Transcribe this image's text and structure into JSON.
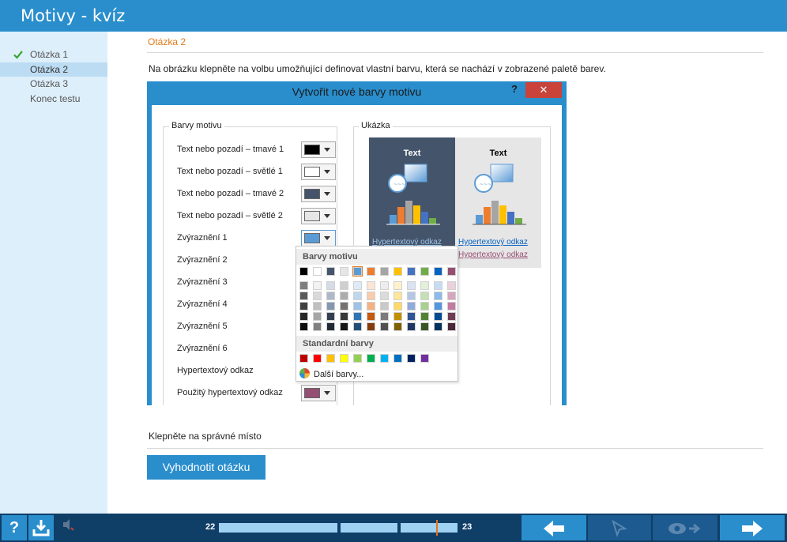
{
  "app": {
    "title": "Motivy - kvíz"
  },
  "sidebar": {
    "items": [
      {
        "label": "Otázka  1",
        "done": true
      },
      {
        "label": "Otázka  2",
        "active": true
      },
      {
        "label": "Otázka  3"
      },
      {
        "label": "Konec testu"
      }
    ]
  },
  "question": {
    "title": "Otázka  2",
    "text": "Na obrázku klepněte na volbu umožňující definovat vlastní barvu, která se nachází v zobrazené paletě barev.",
    "instruction": "Klepněte na správné místo",
    "evaluate_label": "Vyhodnotit otázku"
  },
  "dialog": {
    "title": "Vytvořit nové barvy motivu",
    "help": "?",
    "close": "✕",
    "group_colors": "Barvy motivu",
    "group_preview": "Ukázka",
    "rows": [
      {
        "label": "Text nebo pozadí – tmavé 1",
        "color": "#000000"
      },
      {
        "label": "Text nebo pozadí – světlé 1",
        "color": "#ffffff"
      },
      {
        "label": "Text nebo pozadí – tmavé 2",
        "color": "#44546a"
      },
      {
        "label": "Text nebo pozadí – světlé 2",
        "color": "#e7e6e6"
      },
      {
        "label": "Zvýraznění 1",
        "color": "#5b9bd5"
      },
      {
        "label": "Zvýraznění 2"
      },
      {
        "label": "Zvýraznění 3"
      },
      {
        "label": "Zvýraznění 4"
      },
      {
        "label": "Zvýraznění 5"
      },
      {
        "label": "Zvýraznění 6"
      },
      {
        "label": "Hypertextový odkaz"
      },
      {
        "label": "Použitý hypertextový odkaz",
        "color": "#954f72"
      }
    ],
    "preview": {
      "text_dark": "Text",
      "text_light": "Text",
      "link_dark": "Hypertextový odkaz",
      "link_light": "Hypertextový odkaz",
      "visited_light": "Hypertextový odkaz"
    },
    "palette": {
      "theme_header": "Barvy motivu",
      "standard_header": "Standardní barvy",
      "more_colors": "Další barvy...",
      "theme_colors": [
        "#000000",
        "#ffffff",
        "#44546a",
        "#e7e6e6",
        "#5b9bd5",
        "#ed7d31",
        "#a5a5a5",
        "#ffc000",
        "#4472c4",
        "#70ad47",
        "#0563c1",
        "#954f72"
      ],
      "shades": [
        [
          "#7f7f7f",
          "#f2f2f2",
          "#d6dce5",
          "#d0cece",
          "#deebf7",
          "#fbe5d6",
          "#ededed",
          "#fff2cc",
          "#dae3f3",
          "#e2f0d9",
          "#c5dcf5",
          "#ead1dc"
        ],
        [
          "#595959",
          "#d9d9d9",
          "#adb9ca",
          "#aeabab",
          "#bdd7ee",
          "#f8cbad",
          "#dbdbdb",
          "#ffe699",
          "#b4c7e7",
          "#c5e0b4",
          "#8cbaeb",
          "#d5a6bd"
        ],
        [
          "#404040",
          "#bfbfbf",
          "#8497b0",
          "#757171",
          "#9dc3e6",
          "#f4b183",
          "#c9c9c9",
          "#ffd966",
          "#8faadc",
          "#a9d18e",
          "#5297e0",
          "#c27ba0"
        ],
        [
          "#262626",
          "#a6a6a6",
          "#333f50",
          "#3a3838",
          "#2e75b6",
          "#c55a11",
          "#7b7b7b",
          "#bf9000",
          "#2f5597",
          "#548235",
          "#044a91",
          "#6f3b55"
        ],
        [
          "#0d0d0d",
          "#808080",
          "#222a35",
          "#171616",
          "#1f4e79",
          "#843c0c",
          "#525252",
          "#7f6000",
          "#203864",
          "#385723",
          "#023160",
          "#4a2739"
        ]
      ],
      "standard_colors": [
        "#c00000",
        "#ff0000",
        "#ffc000",
        "#ffff00",
        "#92d050",
        "#00b050",
        "#00b0f0",
        "#0070c0",
        "#002060",
        "#7030a0"
      ]
    }
  },
  "footer": {
    "help": "?",
    "progress_start": "22",
    "progress_end": "23"
  }
}
